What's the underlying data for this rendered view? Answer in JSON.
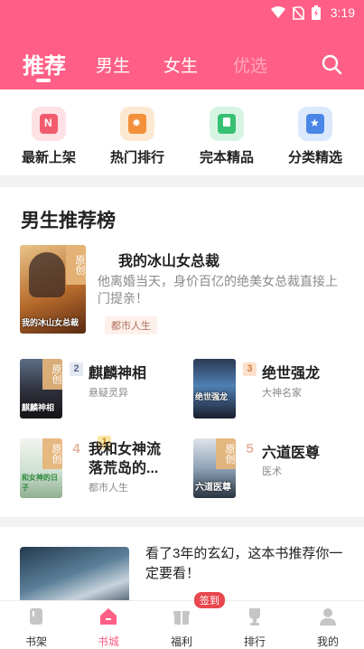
{
  "status": {
    "time": "3:19"
  },
  "tabs": {
    "recommend": "推荐",
    "male": "男生",
    "female": "女生",
    "select": "优选"
  },
  "categories": [
    {
      "label": "最新上架",
      "icon": "new-books-icon",
      "color": "#f25b6e",
      "bg": "#fde1e5"
    },
    {
      "label": "热门排行",
      "icon": "hot-rank-icon",
      "color": "#f2913a",
      "bg": "#fde8d2"
    },
    {
      "label": "完本精品",
      "icon": "finished-books-icon",
      "color": "#36c072",
      "bg": "#d7f4e3"
    },
    {
      "label": "分类精选",
      "icon": "category-icon",
      "color": "#4a86e8",
      "bg": "#dce8fb"
    }
  ],
  "ranking": {
    "title": "男生推荐榜",
    "books": [
      {
        "rank": "1",
        "name": "我的冰山女总裁",
        "desc": "他离婚当天，身价百亿的绝美女总裁直接上门提亲！",
        "tag": "都市人生",
        "ribbon": "原创",
        "cover_title": "我的冰山女总裁"
      },
      {
        "rank": "2",
        "name": "麒麟神相",
        "tag": "悬疑灵异",
        "ribbon": "原创",
        "cover_title": "麒麟神相"
      },
      {
        "rank": "3",
        "name": "绝世强龙",
        "tag": "大神名家",
        "cover_title": "绝世强龙"
      },
      {
        "rank": "4",
        "name": "我和女神流落荒岛的...",
        "tag": "都市人生",
        "ribbon": "原创",
        "cover_title": "和女神的日子"
      },
      {
        "rank": "5",
        "name": "六道医尊",
        "tag": "医术",
        "ribbon": "原创",
        "cover_title": "六道医尊"
      }
    ]
  },
  "recommend": {
    "text": "看了3年的玄幻，这本书推荐你一定要看！"
  },
  "nav": {
    "items": [
      {
        "label": "书架",
        "icon": "bookshelf-icon"
      },
      {
        "label": "书城",
        "icon": "home-icon"
      },
      {
        "label": "福利",
        "icon": "gift-icon"
      },
      {
        "label": "排行",
        "icon": "trophy-icon"
      },
      {
        "label": "我的",
        "icon": "profile-icon"
      }
    ],
    "signin_badge": "签到"
  },
  "colors": {
    "accent": "#ff5f86",
    "badge_red": "#e8474e"
  }
}
